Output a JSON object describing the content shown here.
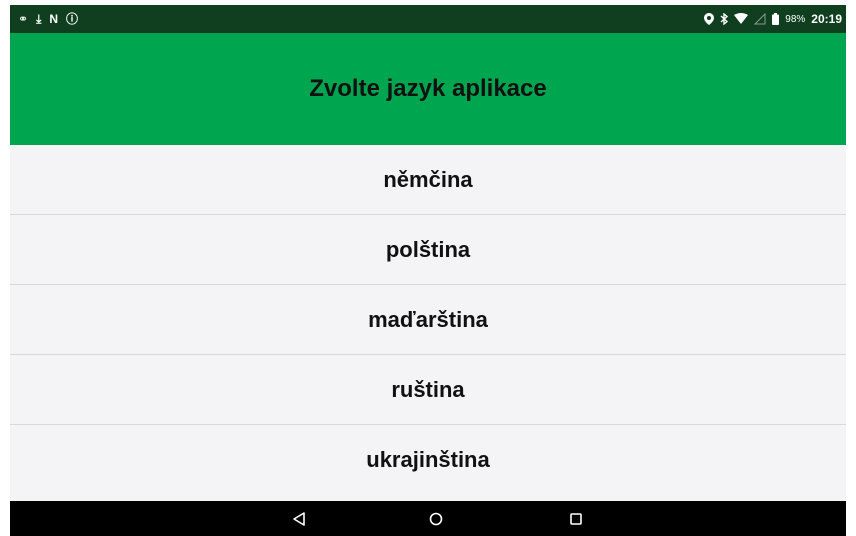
{
  "status_bar": {
    "left_icons": [
      "vpn-key-icon",
      "download-icon",
      "nfc-n-icon",
      "info-icon"
    ],
    "left_glyphs": [
      "⚭",
      "⤓",
      "N",
      "ⓘ"
    ],
    "right_icons": [
      "location-icon",
      "bluetooth-icon",
      "wifi-icon",
      "cellular-icon",
      "battery-icon"
    ],
    "battery": "98%",
    "time": "20:19"
  },
  "header": {
    "title": "Zvolte jazyk aplikace",
    "background": "#00a550"
  },
  "languages": [
    {
      "label": "němčina"
    },
    {
      "label": "polština"
    },
    {
      "label": "maďarština"
    },
    {
      "label": "ruština"
    },
    {
      "label": "ukrajinština"
    }
  ],
  "nav_bar": {
    "buttons": [
      "back-icon",
      "home-icon",
      "recents-icon"
    ]
  }
}
